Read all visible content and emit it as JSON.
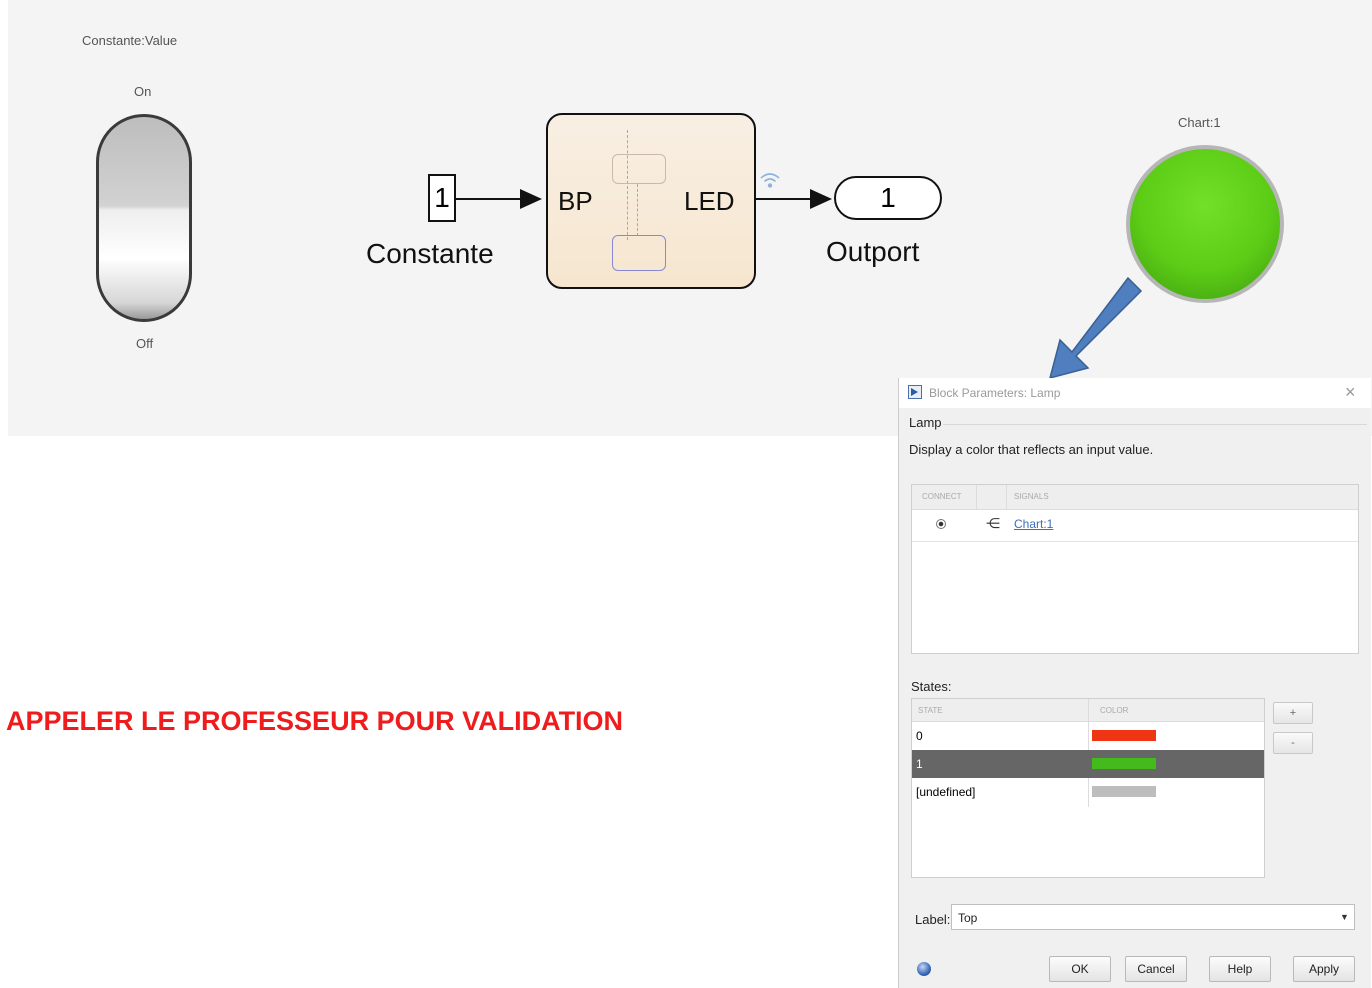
{
  "model": {
    "toggle": {
      "title": "Constante:Value",
      "on_label": "On",
      "off_label": "Off"
    },
    "constant": {
      "value": "1",
      "label": "Constante"
    },
    "chart": {
      "input_port": "BP",
      "output_port": "LED"
    },
    "outport": {
      "value": "1",
      "label": "Outport"
    },
    "lamp": {
      "title": "Chart:1",
      "color": "#5ccc16"
    }
  },
  "validation_message": "APPELER LE PROFESSEUR POUR VALIDATION",
  "dialog": {
    "title": "Block Parameters: Lamp",
    "section": "Lamp",
    "description": "Display a color that reflects an input value.",
    "signals": {
      "headers": [
        "CONNECT",
        "SIGNALS"
      ],
      "rows": [
        {
          "signal": "Chart:1",
          "connected": true
        }
      ]
    },
    "states_label": "States:",
    "states": {
      "headers": [
        "STATE",
        "COLOR"
      ],
      "rows": [
        {
          "state": "0",
          "color": "#f03515"
        },
        {
          "state": "1",
          "color": "#44bb1c",
          "selected": true
        },
        {
          "state": "[undefined]",
          "color": "#bdbdbd"
        }
      ]
    },
    "add_label": "+",
    "remove_label": "-",
    "label_field_label": "Label:",
    "label_value": "Top",
    "buttons": {
      "ok": "OK",
      "cancel": "Cancel",
      "help": "Help",
      "apply": "Apply"
    }
  }
}
